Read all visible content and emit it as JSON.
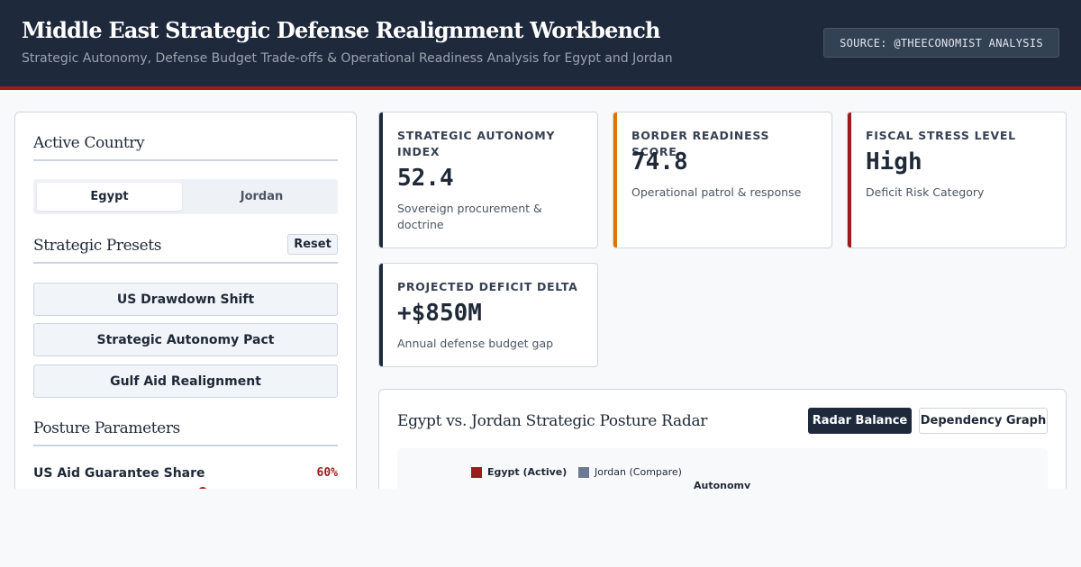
{
  "header": {
    "title": "Middle East Strategic Defense Realignment Workbench",
    "subtitle": "Strategic Autonomy, Defense Budget Trade-offs & Operational Readiness Analysis for Egypt and Jordan",
    "source": "SOURCE: @THEECONOMIST ANALYSIS"
  },
  "sidebar": {
    "country_heading": "Active Country",
    "countries": [
      "Egypt",
      "Jordan"
    ],
    "active_country": "Egypt",
    "presets_heading": "Strategic Presets",
    "reset_label": "Reset",
    "presets": [
      "US Drawdown Shift",
      "Strategic Autonomy Pact",
      "Gulf Aid Realignment"
    ],
    "params_heading": "Posture Parameters",
    "param": {
      "label": "US Aid Guarantee Share",
      "value": "60%",
      "fraction": 0.6
    }
  },
  "kpis": [
    {
      "title": "STRATEGIC AUTONOMY INDEX",
      "value": "52.4",
      "desc": "Sovereign procurement & doctrine",
      "color": "#1e293b"
    },
    {
      "title": "BORDER READINESS SCORE",
      "value": "74.8",
      "desc": "Operational patrol & response",
      "color": "#d97706"
    },
    {
      "title": "FISCAL STRESS LEVEL",
      "value": "High",
      "desc": "Deficit Risk Category",
      "color": "#9b1c1c"
    },
    {
      "title": "PROJECTED DEFICIT DELTA",
      "value": "+$850M",
      "desc": "Annual defense budget gap",
      "color": "#1e293b"
    }
  ],
  "radar": {
    "title": "Egypt vs. Jordan Strategic Posture Radar",
    "views": [
      "Radar Balance",
      "Dependency Graph"
    ],
    "active_view": "Radar Balance",
    "legend": [
      {
        "label": "Egypt (Active)",
        "color": "#9b1c1c"
      },
      {
        "label": "Jordan (Compare)",
        "color": "#6b7a90"
      }
    ],
    "axis_top": "Autonomy"
  }
}
